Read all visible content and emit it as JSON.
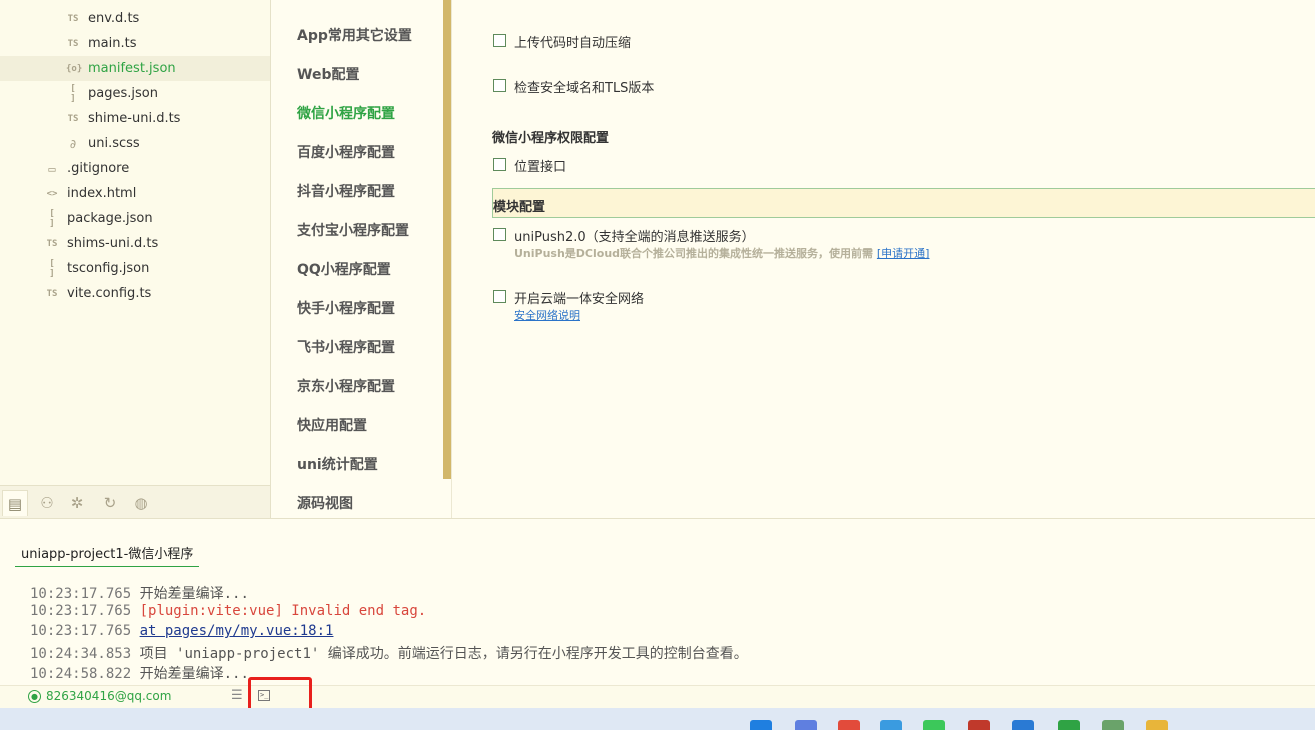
{
  "file_tree": {
    "items": [
      {
        "icon": "TS",
        "label": "env.d.ts",
        "indent": 1
      },
      {
        "icon": "TS",
        "label": "main.ts",
        "indent": 1
      },
      {
        "icon": "{o}",
        "label": "manifest.json",
        "indent": 1,
        "active": true
      },
      {
        "icon": "[ ]",
        "label": "pages.json",
        "indent": 1
      },
      {
        "icon": "TS",
        "label": "shime-uni.d.ts",
        "indent": 1
      },
      {
        "icon": "∂",
        "label": "uni.scss",
        "indent": 1
      },
      {
        "icon": "▭",
        "label": ".gitignore",
        "indent": 0
      },
      {
        "icon": "<>",
        "label": "index.html",
        "indent": 0
      },
      {
        "icon": "[ ]",
        "label": "package.json",
        "indent": 0
      },
      {
        "icon": "TS",
        "label": "shims-uni.d.ts",
        "indent": 0
      },
      {
        "icon": "[ ]",
        "label": "tsconfig.json",
        "indent": 0
      },
      {
        "icon": "TS",
        "label": "vite.config.ts",
        "indent": 0
      }
    ]
  },
  "config_nav": {
    "items": [
      {
        "label": "App常用其它设置",
        "selected": false
      },
      {
        "label": "Web配置",
        "selected": false
      },
      {
        "label": "微信小程序配置",
        "selected": true
      },
      {
        "label": "百度小程序配置",
        "selected": false
      },
      {
        "label": "抖音小程序配置",
        "selected": false
      },
      {
        "label": "支付宝小程序配置",
        "selected": false
      },
      {
        "label": "QQ小程序配置",
        "selected": false
      },
      {
        "label": "快手小程序配置",
        "selected": false
      },
      {
        "label": "飞书小程序配置",
        "selected": false
      },
      {
        "label": "京东小程序配置",
        "selected": false
      },
      {
        "label": "快应用配置",
        "selected": false
      },
      {
        "label": "uni统计配置",
        "selected": false
      },
      {
        "label": "源码视图",
        "selected": false
      }
    ]
  },
  "settings": {
    "upload_compress": "上传代码时自动压缩",
    "check_domain": "检查安全域名和TLS版本",
    "permission_title": "微信小程序权限配置",
    "location_interface": "位置接口",
    "module_title": "模块配置",
    "unipush_label": "uniPush2.0（支持全端的消息推送服务）",
    "unipush_desc": "UniPush是DCloud联合个推公司推出的集成性统一推送服务，使用前需",
    "unipush_link": "[申请开通]",
    "secure_network_label": "开启云端一体安全网络",
    "secure_network_link": "安全网络说明"
  },
  "console": {
    "tab_label": "uniapp-project1-微信小程序",
    "logs": [
      {
        "time": "10:23:17.765",
        "text": "开始差量编译...",
        "style": "normal"
      },
      {
        "time": "10:23:17.765",
        "text": "[plugin:vite:vue] Invalid end tag.",
        "style": "error"
      },
      {
        "time": "10:23:17.765",
        "text": "at pages/my/my.vue:18:1",
        "style": "link"
      },
      {
        "time": "10:24:34.853",
        "text": "项目 'uniapp-project1' 编译成功。前端运行日志，请另行在小程序开发工具的控制台查看。",
        "style": "normal"
      },
      {
        "time": "10:24:58.822",
        "text": "开始差量编译...",
        "style": "normal"
      }
    ]
  },
  "statusbar": {
    "account": "826340416@qq.com"
  },
  "colors": {
    "accent_green": "#2fa344",
    "highlight_red": "#e8201c",
    "error_red": "#d8463c",
    "link_blue": "#2b73c8",
    "scroll_gold": "#d2b76a"
  }
}
